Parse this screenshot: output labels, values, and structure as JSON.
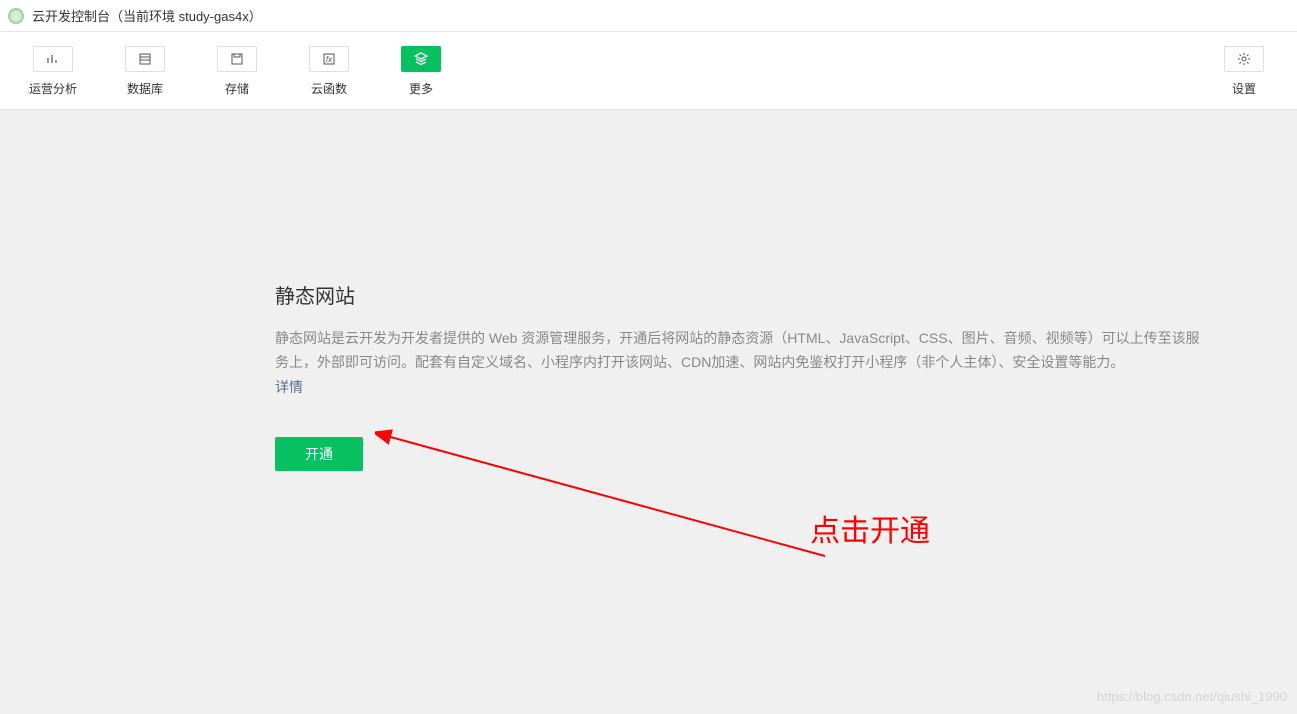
{
  "window": {
    "title": "云开发控制台（当前环境 study-gas4x）"
  },
  "toolbar": {
    "items": [
      {
        "label": "运营分析",
        "icon": "analytics-icon"
      },
      {
        "label": "数据库",
        "icon": "database-icon"
      },
      {
        "label": "存储",
        "icon": "storage-icon"
      },
      {
        "label": "云函数",
        "icon": "function-icon"
      },
      {
        "label": "更多",
        "icon": "more-icon",
        "active": true
      }
    ],
    "settings_label": "设置"
  },
  "main": {
    "title": "静态网站",
    "description": "静态网站是云开发为开发者提供的 Web 资源管理服务，开通后将网站的静态资源（HTML、JavaScript、CSS、图片、音频、视频等）可以上传至该服务上，外部即可访问。配套有自定义域名、小程序内打开该网站、CDN加速、网站内免鉴权打开小程序（非个人主体）、安全设置等能力。",
    "detail_link": "详情",
    "action_button": "开通"
  },
  "annotation": {
    "text": "点击开通"
  },
  "watermark": "https://blog.csdn.net/qiushi_1990"
}
